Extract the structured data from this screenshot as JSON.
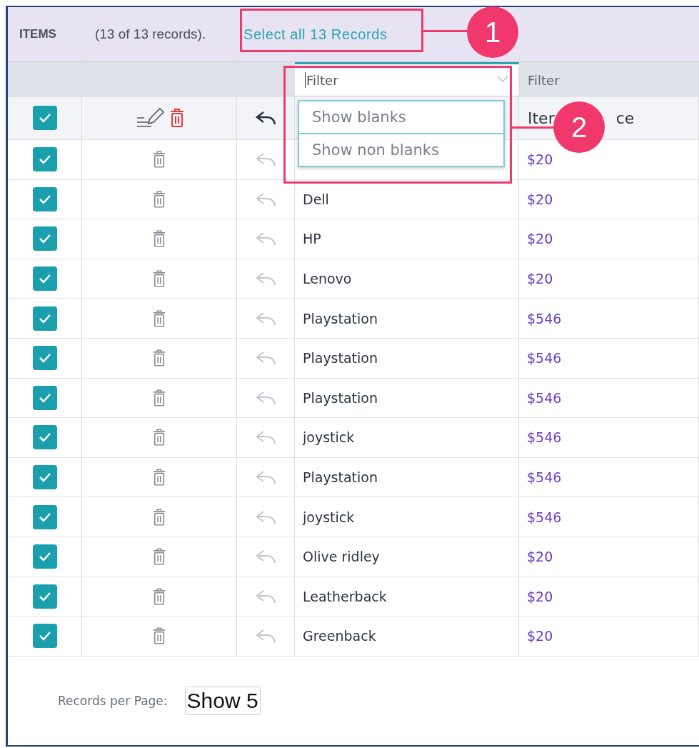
{
  "header": {
    "title": "ITEMS",
    "count": "(13 of 13 records).",
    "select_all_link": "Select all 13 Records"
  },
  "filters": [
    {
      "placeholder": "Filter",
      "active": true
    },
    {
      "placeholder": "Filter",
      "active": false
    }
  ],
  "dropdown": {
    "options": [
      "Show blanks",
      "Show non blanks"
    ]
  },
  "column_headers": {
    "select_all_checked": true,
    "column_5": [
      "Iter",
      "ce"
    ]
  },
  "rows": [
    {
      "checked": true,
      "price": "$20"
    },
    {
      "checked": true,
      "name": "Dell",
      "price": "$20"
    },
    {
      "checked": true,
      "name": "HP",
      "price": "$20"
    },
    {
      "checked": true,
      "name": "Lenovo",
      "price": "$20"
    },
    {
      "checked": true,
      "name": "Playstation",
      "price": "$546"
    },
    {
      "checked": true,
      "name": "Playstation",
      "price": "$546"
    },
    {
      "checked": true,
      "name": "Playstation",
      "price": "$546"
    },
    {
      "checked": true,
      "name": "joystick",
      "price": "$546"
    },
    {
      "checked": true,
      "name": "Playstation",
      "price": "$546"
    },
    {
      "checked": true,
      "name": "joystick",
      "price": "$546"
    },
    {
      "checked": true,
      "name": "Olive ridley",
      "price": "$20"
    },
    {
      "checked": true,
      "name": "Leatherback",
      "price": "$20"
    },
    {
      "checked": true,
      "name": "Greenback",
      "price": "$20"
    }
  ],
  "footer": {
    "label": "Records per Page:",
    "page_size": "Show 5"
  },
  "annotations": [
    {
      "number": "1"
    },
    {
      "number": "2"
    }
  ]
}
